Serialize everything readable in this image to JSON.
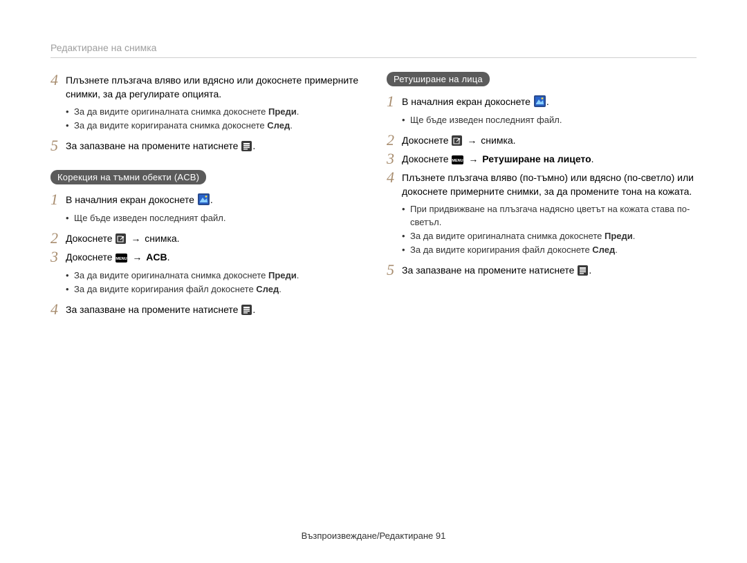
{
  "header": {
    "title": "Редактиране на снимка"
  },
  "strings": {
    "arrow": "→",
    "bold": {
      "predi": "Преди",
      "sled": "След",
      "acb": "ACB",
      "retouch": "Ретуширане на лицето"
    },
    "part": {
      "home_tap_prefix": "В началния екран докоснете ",
      "tap_prefix": "Докоснете ",
      "save_prefix": "За запазване на промените натиснете ",
      "snimka": " снимка.",
      "bullet_orig_prefix": "За да видите оригиналната снимка докоснете ",
      "bullet_corr_img_prefix": "За да видите коригираната снимка докоснете ",
      "bullet_corr_file_prefix": "За да видите коригирания файл докоснете ",
      "home_tap_suffix": ".",
      "save_suffix": "."
    }
  },
  "left": {
    "step4": "Плъзнете плъзгача вляво или вдясно или докоснете примерните снимки, за да регулирате опцията.",
    "step5_num": "5",
    "pill": "Корекция на тъмни обекти (ACB)",
    "acb": {
      "bullet1": "Ще бъде изведен последният файл."
    }
  },
  "right": {
    "pill": "Ретуширане на лица",
    "bullet_homefile": "Ще бъде изведен последният файл.",
    "step4": "Плъзнете плъзгача вляво (по-тъмно) или вдясно (по-светло) или докоснете примерните снимки, за да промените тона на кожата.",
    "bullet_slider": "При придвижване на плъзгача надясно цветът на кожата става по-светъл."
  },
  "footer": {
    "text": "Възпроизвеждане/Редактиране  91"
  }
}
